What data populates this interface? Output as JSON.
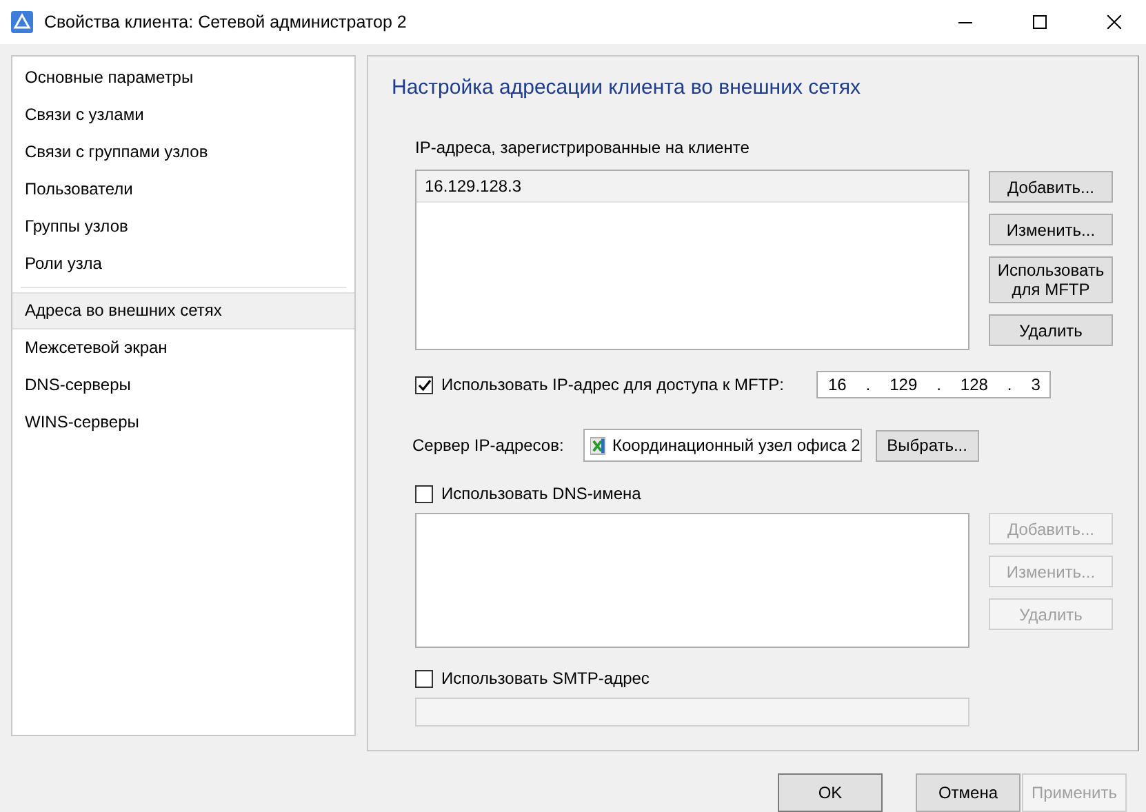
{
  "window": {
    "title": "Свойства клиента: Сетевой администратор 2"
  },
  "sidebar": {
    "groups": [
      [
        {
          "label": "Основные параметры",
          "selected": false
        },
        {
          "label": "Связи с узлами",
          "selected": false
        },
        {
          "label": "Связи с группами узлов",
          "selected": false
        },
        {
          "label": "Пользователи",
          "selected": false
        },
        {
          "label": "Группы узлов",
          "selected": false
        },
        {
          "label": "Роли узла",
          "selected": false
        }
      ],
      [
        {
          "label": "Адреса во внешних сетях",
          "selected": true
        },
        {
          "label": "Межсетевой экран",
          "selected": false
        },
        {
          "label": "DNS-серверы",
          "selected": false
        },
        {
          "label": "WINS-серверы",
          "selected": false
        }
      ]
    ]
  },
  "panel": {
    "heading": "Настройка адресации клиента во внешних сетях",
    "ip_list": {
      "label": "IP-адреса, зарегистрированные на клиенте",
      "rows": [
        {
          "text": "16.129.128.3",
          "selected": true
        }
      ],
      "buttons": [
        {
          "label": "Добавить...",
          "disabled": false
        },
        {
          "label": "Изменить...",
          "disabled": false
        },
        {
          "label": "Использовать для MFTP",
          "disabled": false
        },
        {
          "label": "Удалить",
          "disabled": false
        }
      ]
    },
    "mftp": {
      "label": "Использовать IP-адрес для доступа к MFTP:",
      "checked": true,
      "octets": [
        "16",
        "129",
        "128",
        "3"
      ],
      "separator": "."
    },
    "server": {
      "label": "Сервер IP-адресов:",
      "value": "Координационный узел офиса 2",
      "button": "Выбрать..."
    },
    "dns": {
      "label": "Использовать DNS-имена",
      "checked": false,
      "buttons": [
        {
          "label": "Добавить...",
          "disabled": true
        },
        {
          "label": "Изменить...",
          "disabled": true
        },
        {
          "label": "Удалить",
          "disabled": true
        }
      ]
    },
    "smtp": {
      "label": "Использовать SMTP-адрес",
      "checked": false,
      "disabled": true
    }
  },
  "footer": [
    {
      "label": "OK",
      "disabled": false,
      "default": true
    },
    {
      "label": "Отмена",
      "disabled": false,
      "default": false
    },
    {
      "label": "Применить",
      "disabled": true,
      "default": false
    }
  ]
}
